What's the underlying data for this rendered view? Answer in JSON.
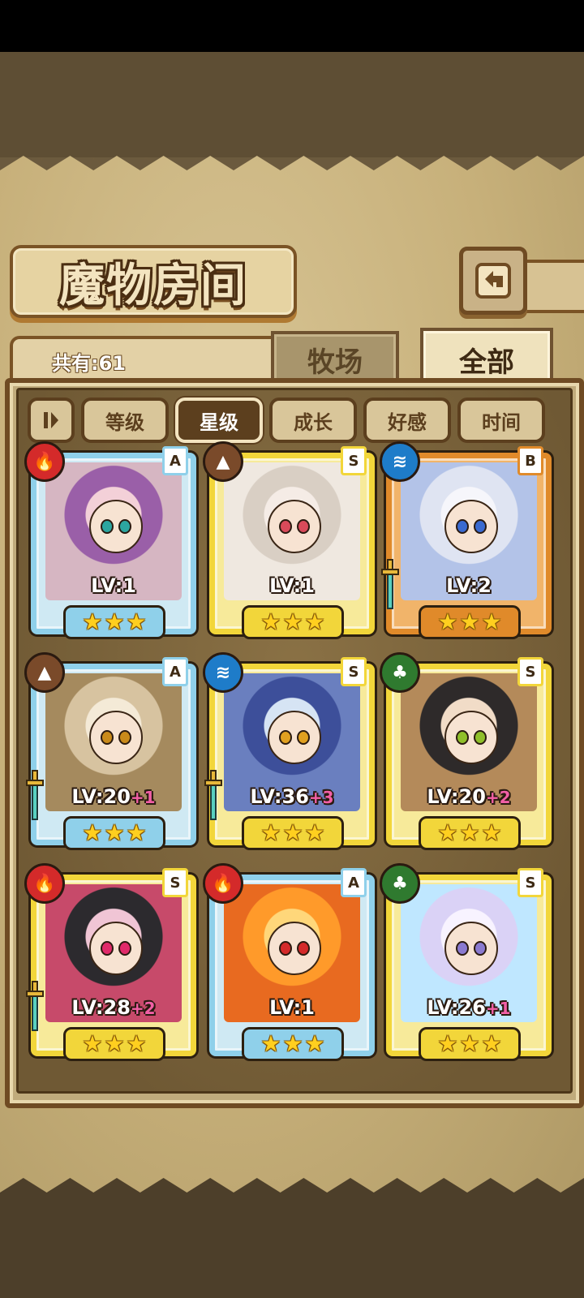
{
  "screen": {
    "title": "魔物房间",
    "count_label": "共有:61",
    "back_icon": "back-arrow-icon"
  },
  "tabs": [
    {
      "label": "牧场",
      "active": false
    },
    {
      "label": "全部",
      "active": true
    }
  ],
  "sort": {
    "toggle_icon": "sort-order-icon",
    "buttons": [
      {
        "label": "等级",
        "active": false
      },
      {
        "label": "星级",
        "active": true
      },
      {
        "label": "成长",
        "active": false
      },
      {
        "label": "好感",
        "active": false
      },
      {
        "label": "时间",
        "active": false
      }
    ]
  },
  "colors": {
    "frame_blue": "#8fd0ea",
    "frame_yellow": "#f2d63a",
    "frame_orange": "#e08a2a",
    "element_fire": "#d42a2a",
    "element_earth": "#7a4a2a",
    "element_water": "#1e7cc9",
    "element_wood": "#2f7a2f"
  },
  "monsters": [
    {
      "level": "LV:1",
      "bonus": "",
      "rarity": "A",
      "element": "fire",
      "frame": "blue",
      "stars": 3,
      "equipped": false
    },
    {
      "level": "LV:1",
      "bonus": "",
      "rarity": "S",
      "element": "earth",
      "frame": "yellow",
      "stars": 3,
      "equipped": false
    },
    {
      "level": "LV:2",
      "bonus": "",
      "rarity": "B",
      "element": "water",
      "frame": "orange",
      "stars": 3,
      "equipped": true
    },
    {
      "level": "LV:20",
      "bonus": "+1",
      "rarity": "A",
      "element": "earth",
      "frame": "blue",
      "stars": 3,
      "equipped": true
    },
    {
      "level": "LV:36",
      "bonus": "+3",
      "rarity": "S",
      "element": "water",
      "frame": "yellow",
      "stars": 3,
      "equipped": true
    },
    {
      "level": "LV:20",
      "bonus": "+2",
      "rarity": "S",
      "element": "wood",
      "frame": "yellow",
      "stars": 3,
      "equipped": false
    },
    {
      "level": "LV:28",
      "bonus": "+2",
      "rarity": "S",
      "element": "fire",
      "frame": "yellow",
      "stars": 3,
      "equipped": true
    },
    {
      "level": "LV:1",
      "bonus": "",
      "rarity": "A",
      "element": "fire",
      "frame": "blue",
      "stars": 3,
      "equipped": false
    },
    {
      "level": "LV:26",
      "bonus": "+1",
      "rarity": "S",
      "element": "wood",
      "frame": "yellow",
      "stars": 3,
      "equipped": false
    }
  ]
}
